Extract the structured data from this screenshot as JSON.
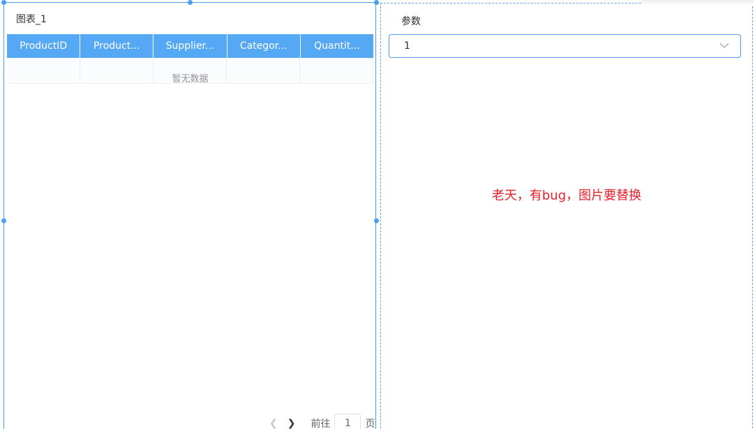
{
  "widget_chart": {
    "title": "图表_1",
    "columns": [
      "ProductID",
      "Product...",
      "Supplier...",
      "Categor...",
      "Quantit..."
    ],
    "empty_text": "暂无数据",
    "pagination": {
      "goto_label": "前往",
      "page_value": "1",
      "page_unit": "页"
    }
  },
  "widget_param": {
    "label": "参数",
    "selected_value": "1",
    "note": "老天，有bug，图片要替换"
  },
  "colors": {
    "accent": "#4a9ff5",
    "header_bg": "#55a8f3",
    "note": "#e5202a"
  }
}
